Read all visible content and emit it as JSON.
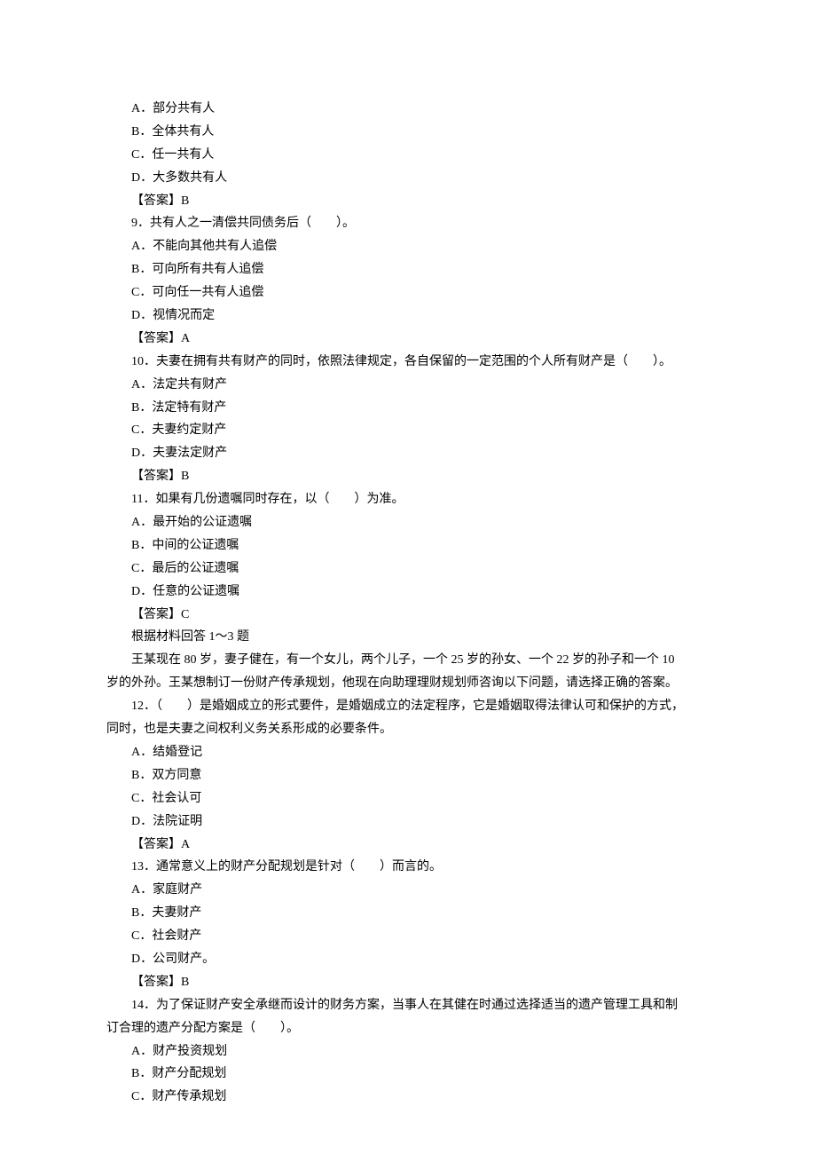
{
  "lines": [
    "A．部分共有人",
    "B．全体共有人",
    "C．任一共有人",
    "D．大多数共有人",
    "【答案】B",
    "9．共有人之一清偿共同债务后（　　）。",
    "A．不能向其他共有人追偿",
    "B．可向所有共有人追偿",
    "C．可向任一共有人追偿",
    "D．视情况而定",
    "【答案】A",
    "10．夫妻在拥有共有财产的同时，依照法律规定，各自保留的一定范围的个人所有财产是（　　）。",
    "A．法定共有财产",
    "B．法定特有财产",
    "C．夫妻约定财产",
    "D．夫妻法定财产",
    "【答案】B",
    "11．如果有几份遗嘱同时存在，以（　　）为准。",
    "A．最开始的公证遗嘱",
    "B．中间的公证遗嘱",
    "C．最后的公证遗嘱",
    "D．任意的公证遗嘱",
    "【答案】C",
    "根据材料回答 1～3 题",
    "王某现在 80 岁，妻子健在，有一个女儿，两个儿子，一个 25 岁的孙女、一个 22 岁的孙子和一个 10",
    {
      "text": "岁的外孙。王某想制订一份财产传承规划，他现在向助理理财规划师咨询以下问题，请选择正确的答案。",
      "noindent": true
    },
    "12．（　　）是婚姻成立的形式要件，是婚姻成立的法定程序，它是婚姻取得法律认可和保护的方式，",
    {
      "text": "同时，也是夫妻之间权利义务关系形成的必要条件。",
      "noindent": true
    },
    "A．结婚登记",
    "B．双方同意",
    "C．社会认可",
    "D．法院证明",
    "【答案】A",
    "13．通常意义上的财产分配规划是针对（　　）而言的。",
    "A．家庭财产",
    "B．夫妻财产",
    "C．社会财产",
    "D．公司财产。",
    "【答案】B",
    "14．为了保证财产安全承继而设计的财务方案，当事人在其健在时通过选择适当的遗产管理工具和制",
    {
      "text": "订合理的遗产分配方案是（　　）。",
      "noindent": true
    },
    "A．财产投资规划",
    "B．财产分配规划",
    "C．财产传承规划"
  ]
}
